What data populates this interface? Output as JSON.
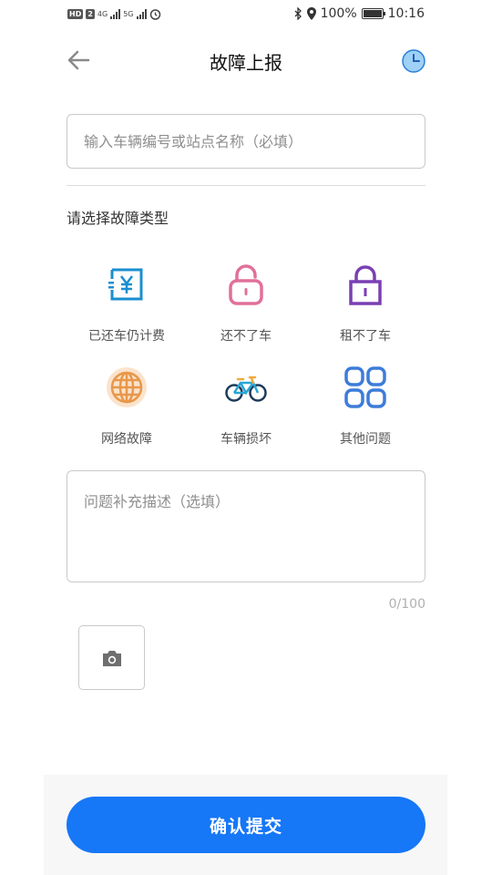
{
  "status_bar": {
    "left_badges": [
      "HD",
      "2"
    ],
    "network_1": "4G",
    "network_2": "5G",
    "battery": "100%",
    "battery_level": 1.0,
    "time": "10:16",
    "icons": [
      "bluetooth-icon",
      "location-icon",
      "battery-icon",
      "alarm-icon"
    ]
  },
  "header": {
    "title": "故障上报",
    "back_icon": "arrow-left-icon",
    "history_icon": "clock-icon"
  },
  "form": {
    "vehicle_placeholder": "输入车辆编号或站点名称（必填）",
    "section_label": "请选择故障类型",
    "fault_types": [
      {
        "label": "已还车仍计费",
        "icon": "billing-icon",
        "color": "#1a8fd1"
      },
      {
        "label": "还不了车",
        "icon": "unlock-icon",
        "color": "#e0709a"
      },
      {
        "label": "租不了车",
        "icon": "lock-icon",
        "color": "#7a3fb4"
      },
      {
        "label": "网络故障",
        "icon": "globe-icon",
        "color": "#e8974a"
      },
      {
        "label": "车辆损坏",
        "icon": "bicycle-icon",
        "color": "#2aa6d6"
      },
      {
        "label": "其他问题",
        "icon": "grid-icon",
        "color": "#3d7cd9"
      }
    ],
    "description_placeholder": "问题补充描述（选填）",
    "char_counter": "0/100",
    "camera_icon": "camera-icon"
  },
  "footer": {
    "submit_label": "确认提交",
    "accent": "#1677f7"
  }
}
